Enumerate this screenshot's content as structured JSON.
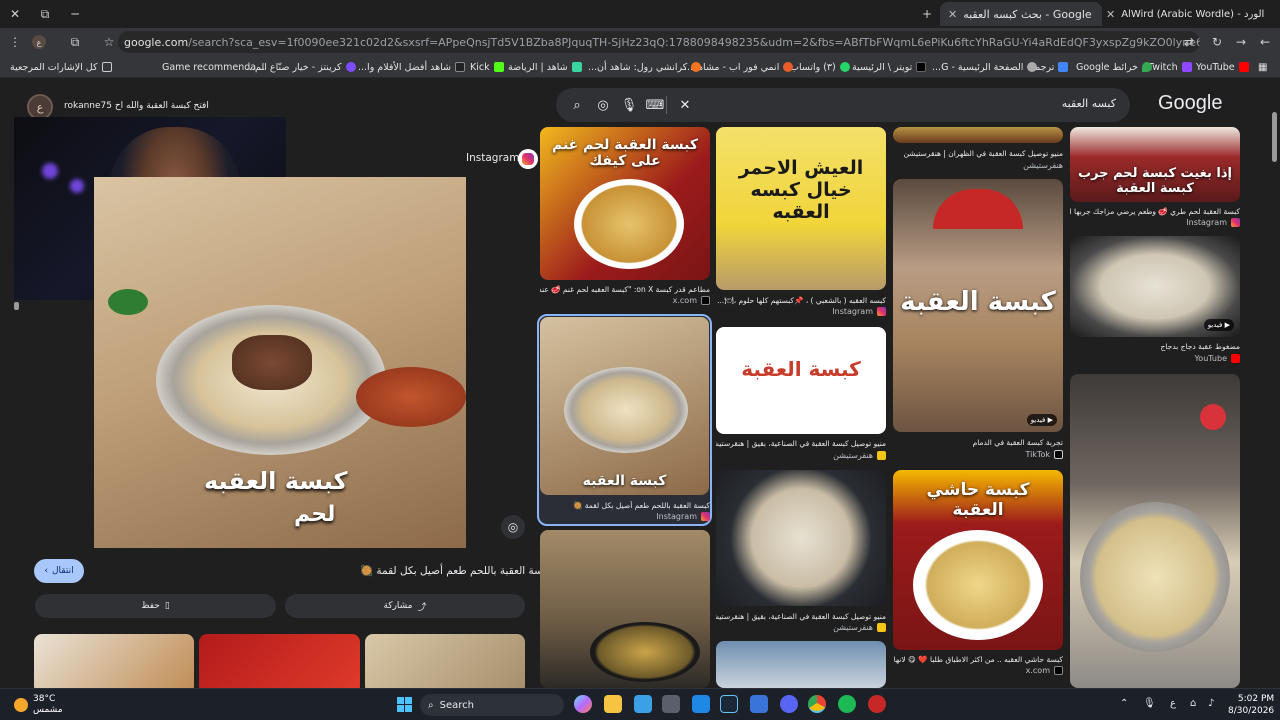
{
  "browser": {
    "tabs": [
      {
        "label": "Google - بحث كبسه العقبه",
        "active": true
      },
      {
        "label": "AlWird (Arabic Wordle) - الورد",
        "active": false
      }
    ],
    "url_main": "google.com",
    "url_rest": "/search?sca_esv=1f0090ee321c02d2&sxsrf=APpeQnsjTd5V1BZba8PJquqTH-SjHz23qQ:1788098498235&udm=2&fbs=ABfTbFWqmL6ePiKu6ftcYhRaGU-Yi4aRdEdQF3yxspZg9kZO0lyne6o4cNqzFZotmJxuDnDyPlrMsZXfwkPH0kFUFVebgLVRd-ZTf0..."
  },
  "bookmarks": [
    "YouTube",
    "Twitch",
    "خرائط Google",
    "ترجمة",
    "الصفحة الرئيسية - G...",
    "تويتر \\ الرئيسية",
    "(٣) واتساب",
    "انمي فور اب - مشاهد...",
    "كرانشي رول: شاهد أن...",
    "شاهد | الرياضة",
    "Kick",
    "شاهد أفضل الأفلام وا...",
    "كرينتز - خيار صنّاع الم...",
    "Game recommenda...",
    "كل الإشارات المرجعية"
  ],
  "search": {
    "logo": "Google",
    "query": "كبسه العقبه"
  },
  "panel": {
    "account_initial": "ع",
    "stream_name": "rokanne75 افتح كبسة العقبة والله اح",
    "source": "Instagram",
    "image_caption": "كبسة العقبه",
    "image_caption2": "لحم",
    "title": "كبسة العقبة باللحم طعم أصيل بكل لقمة 🥘",
    "visit_label": "انتقال",
    "share_label": "مشاركة",
    "save_label": "حفظ"
  },
  "results": [
    {
      "caption": "كبسة العقبة لحم غنم على كيفك",
      "title": "مطاعم قدر كبسة on X: \"كبسة العقبه لحم غنم 🥩 عندنا كبس...",
      "source": "x.com",
      "src_color": "#000000"
    },
    {
      "caption": "العيش الاحمر خيال كبسه العقبه",
      "title": "كبسه العقبه ( بالشعبي ) ، 📌كبستهم كلها حلوم ،🍽...",
      "source": "Instagram",
      "src_color": "#e1306c"
    },
    {
      "caption": "",
      "title": "منيو توصيل كبسة العقبة في الظهران | هنقرستيشن",
      "source": "هنقرستيشن",
      "src_color": "#f5c518"
    },
    {
      "caption": "إذا بغيت كبسة لحم جرب كبسة العقبة",
      "title": "كبسة العقبة لحم طري 🥩 وطعم يرضي مزاجك جربها الحين...",
      "source": "Instagram",
      "src_color": "#e1306c"
    },
    {
      "caption": "",
      "title": "كبسة العقبة باللحم طعم أصيل بكل لقمة 🥘",
      "source": "Instagram",
      "src_color": "#e1306c"
    },
    {
      "caption": "كبسة العقبة",
      "title": "منيو توصيل كبسة العقبة في الصناعية، بقيق | هنقرستيشن",
      "source": "هنقرستيشن",
      "src_color": "#f5c518"
    },
    {
      "caption": "كبسة العقبة",
      "title": "تجربة كبسة العقبة في الدمام",
      "source": "TikTok",
      "src_color": "#ffffff"
    },
    {
      "caption": "",
      "title": "مضغوط عقبة دجاج بدجاج",
      "source": "YouTube",
      "src_color": "#ff0000"
    },
    {
      "caption": "",
      "title": "منيو توصيل كبسة العقبة في الصناعية، بقيق | هنقرستيشن",
      "source": "هنقرستيشن",
      "src_color": "#f5c518"
    },
    {
      "caption": "كبسة حاشي العقبة",
      "title": "كبسة حاشي العقبه .. من اكثر الاطباق طلبا ❤️ 😋 لانها ديهم...",
      "source": "x.com",
      "src_color": "#000000"
    },
    {
      "caption": "",
      "title": "",
      "source": "",
      "src_color": "#000000"
    }
  ],
  "video_badge": "فيديو",
  "taskbar": {
    "temp": "38°C",
    "condition": "مشمس",
    "search_label": "Search",
    "lang": "ع",
    "time": "5:02 PM",
    "date": "8/30/2026"
  }
}
